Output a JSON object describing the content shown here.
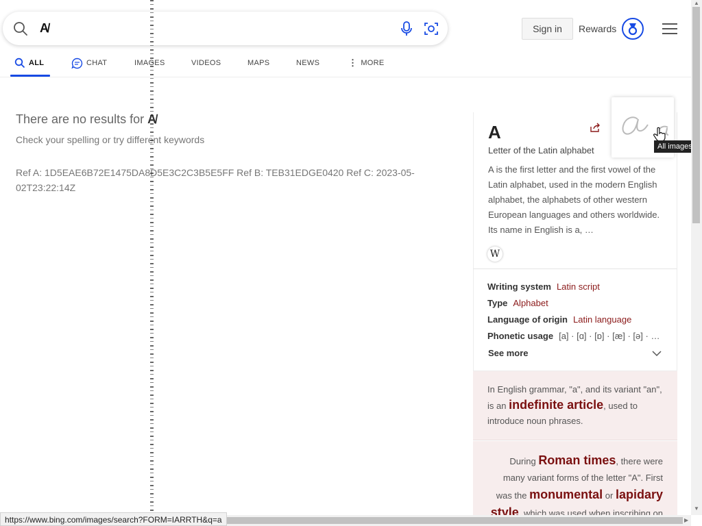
{
  "search": {
    "query": "A̸"
  },
  "header": {
    "signin_label": "Sign in",
    "rewards_label": "Rewards"
  },
  "tabs": [
    {
      "label": "ALL",
      "icon": "search-icon"
    },
    {
      "label": "CHAT",
      "icon": "chat-icon"
    },
    {
      "label": "IMAGES"
    },
    {
      "label": "VIDEOS"
    },
    {
      "label": "MAPS"
    },
    {
      "label": "NEWS"
    },
    {
      "label": "MORE",
      "icon": "more-vertical-icon"
    }
  ],
  "results": {
    "no_results_prefix": "There are no results for",
    "no_results_query": "A̸",
    "hint": "Check your spelling or try different keywords",
    "ref": "Ref A: 1D5EAE6B72E1475DA8D5E3C2C3B5E5FF Ref B: TEB31EDGE0420 Ref C: 2023-05-02T23:22:14Z"
  },
  "panel": {
    "title": "A",
    "subtitle": "Letter of the Latin alphabet",
    "description": "A is the first letter and the first vowel of the Latin alphabet, used in the modern English alphabet, the alphabets of other western European languages and others worldwide. Its name in English is a, …",
    "wiki_icon": "W",
    "facts": [
      {
        "key": "Writing system",
        "value": "Latin script"
      },
      {
        "key": "Type",
        "value": "Alphabet"
      },
      {
        "key": "Language of origin",
        "value": "Latin language"
      },
      {
        "key": "Phonetic usage",
        "value": "[a] · [ɑ] · [ɒ] · [æ] · [ə] · …"
      }
    ],
    "see_more": "See more",
    "fact1": {
      "pre": "In English grammar, \"a\", and its variant \"an\", is an",
      "highlight": "indefinite article",
      "post": ", used to introduce noun phrases."
    },
    "fact2": {
      "pre": "During",
      "h1": "Roman times",
      "mid1": ", there were many variant forms of the letter \"A\". First was the",
      "h2": "monumental",
      "mid2": "or",
      "h3": "lapidary",
      "h4": "style",
      "post": ", which was used when inscribing on"
    },
    "tooltip": "All images"
  },
  "status_url": "https://www.bing.com/images/search?FORM=IARRTH&q=a",
  "colors": {
    "accent": "#174ae4",
    "fact_link": "#8b1a1a",
    "fact_bg": "#f7eded"
  }
}
